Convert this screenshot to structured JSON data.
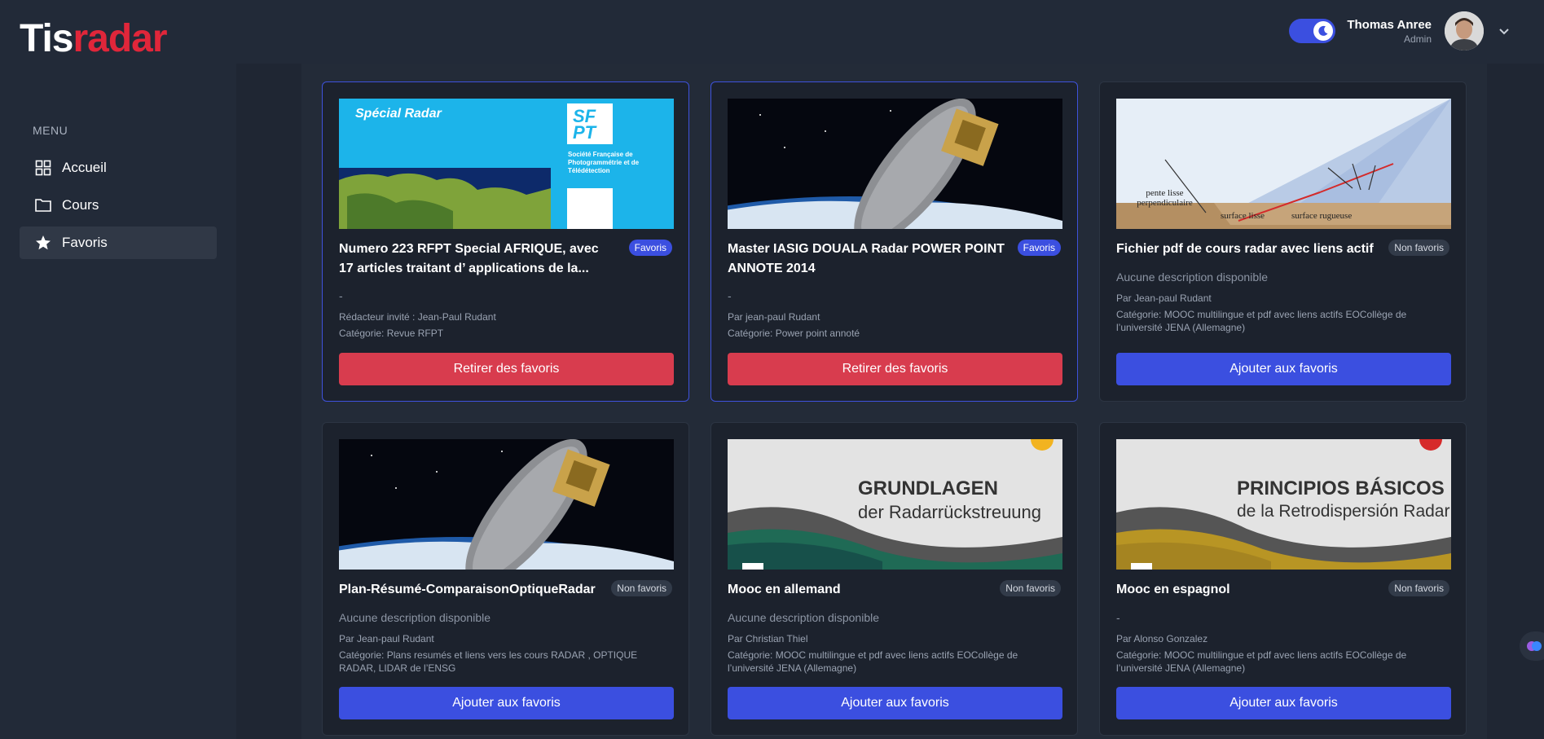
{
  "brand": {
    "part1": "Tis",
    "part2": "radar"
  },
  "user": {
    "name": "Thomas Anree",
    "role": "Admin"
  },
  "icons": {
    "theme_toggle": "moon-icon",
    "dropdown": "chevron-down-icon",
    "home": "grid-icon",
    "courses": "folder-icon",
    "favorites": "star-icon"
  },
  "sidebar": {
    "menu_label": "MENU",
    "items": [
      {
        "label": "Accueil"
      },
      {
        "label": "Cours"
      },
      {
        "label": "Favoris"
      }
    ]
  },
  "colors": {
    "accent": "#3b4fe0",
    "danger": "#d83c4e",
    "brand_red": "#e0263a"
  },
  "cards": [
    {
      "title": "Numero 223 RFPT Special AFRIQUE, avec 17 articles traitant d’ applications de la...",
      "badge": "Favoris",
      "desc": "-",
      "line1": "Rédacteur invité : Jean-Paul Rudant",
      "line2": "Catégorie: Revue RFPT",
      "button": "Retirer des favoris",
      "image_text_1": "Spécial Radar",
      "image_text_2": "SF PT",
      "image_text_3": "Société Française de Photogrammétrie et de Télédétection"
    },
    {
      "title": "Master IASIG DOUALA Radar POWER POINT ANNOTE 2014",
      "badge": "Favoris",
      "desc": "-",
      "line1": "Par jean-paul Rudant",
      "line2": "Catégorie: Power point annoté",
      "button": "Retirer des favoris"
    },
    {
      "title": "Fichier pdf de cours radar avec liens actif",
      "badge": "Non favoris",
      "desc": "Aucune description disponible",
      "line1": "Par Jean-paul Rudant",
      "line2": "Catégorie: MOOC multilingue et pdf avec liens actifs  EOCollège de l’université JENA (Allemagne)",
      "button": "Ajouter aux favoris",
      "image_text_1": "pente lisse perpendiculaire",
      "image_text_2": "surface lisse",
      "image_text_3": "surface rugueuse"
    },
    {
      "title": "Plan-Résumé-ComparaisonOptiqueRadar",
      "badge": "Non favoris",
      "desc": "Aucune description disponible",
      "line1": "Par Jean-paul Rudant",
      "line2": "Catégorie: Plans resumés et liens vers les cours RADAR , OPTIQUE RADAR, LIDAR de l’ENSG",
      "button": "Ajouter aux favoris"
    },
    {
      "title": "Mooc en allemand",
      "badge": "Non favoris",
      "desc": "Aucune description disponible",
      "line1": "Par Christian Thiel",
      "line2": "Catégorie: MOOC multilingue et pdf avec liens actifs  EOCollège de l’université JENA (Allemagne)",
      "button": "Ajouter aux favoris",
      "image_text_1": "GRUNDLAGEN",
      "image_text_2": "der Radarrückstreuung"
    },
    {
      "title": "Mooc en espagnol",
      "badge": "Non favoris",
      "desc": "-",
      "line1": "Par Alonso Gonzalez",
      "line2": "Catégorie: MOOC multilingue et pdf avec liens actifs  EOCollège de l’université JENA (Allemagne)",
      "button": "Ajouter aux favoris",
      "image_text_1": "PRINCIPIOS BÁSICOS",
      "image_text_2": "de la Retrodispersión Radar"
    }
  ]
}
